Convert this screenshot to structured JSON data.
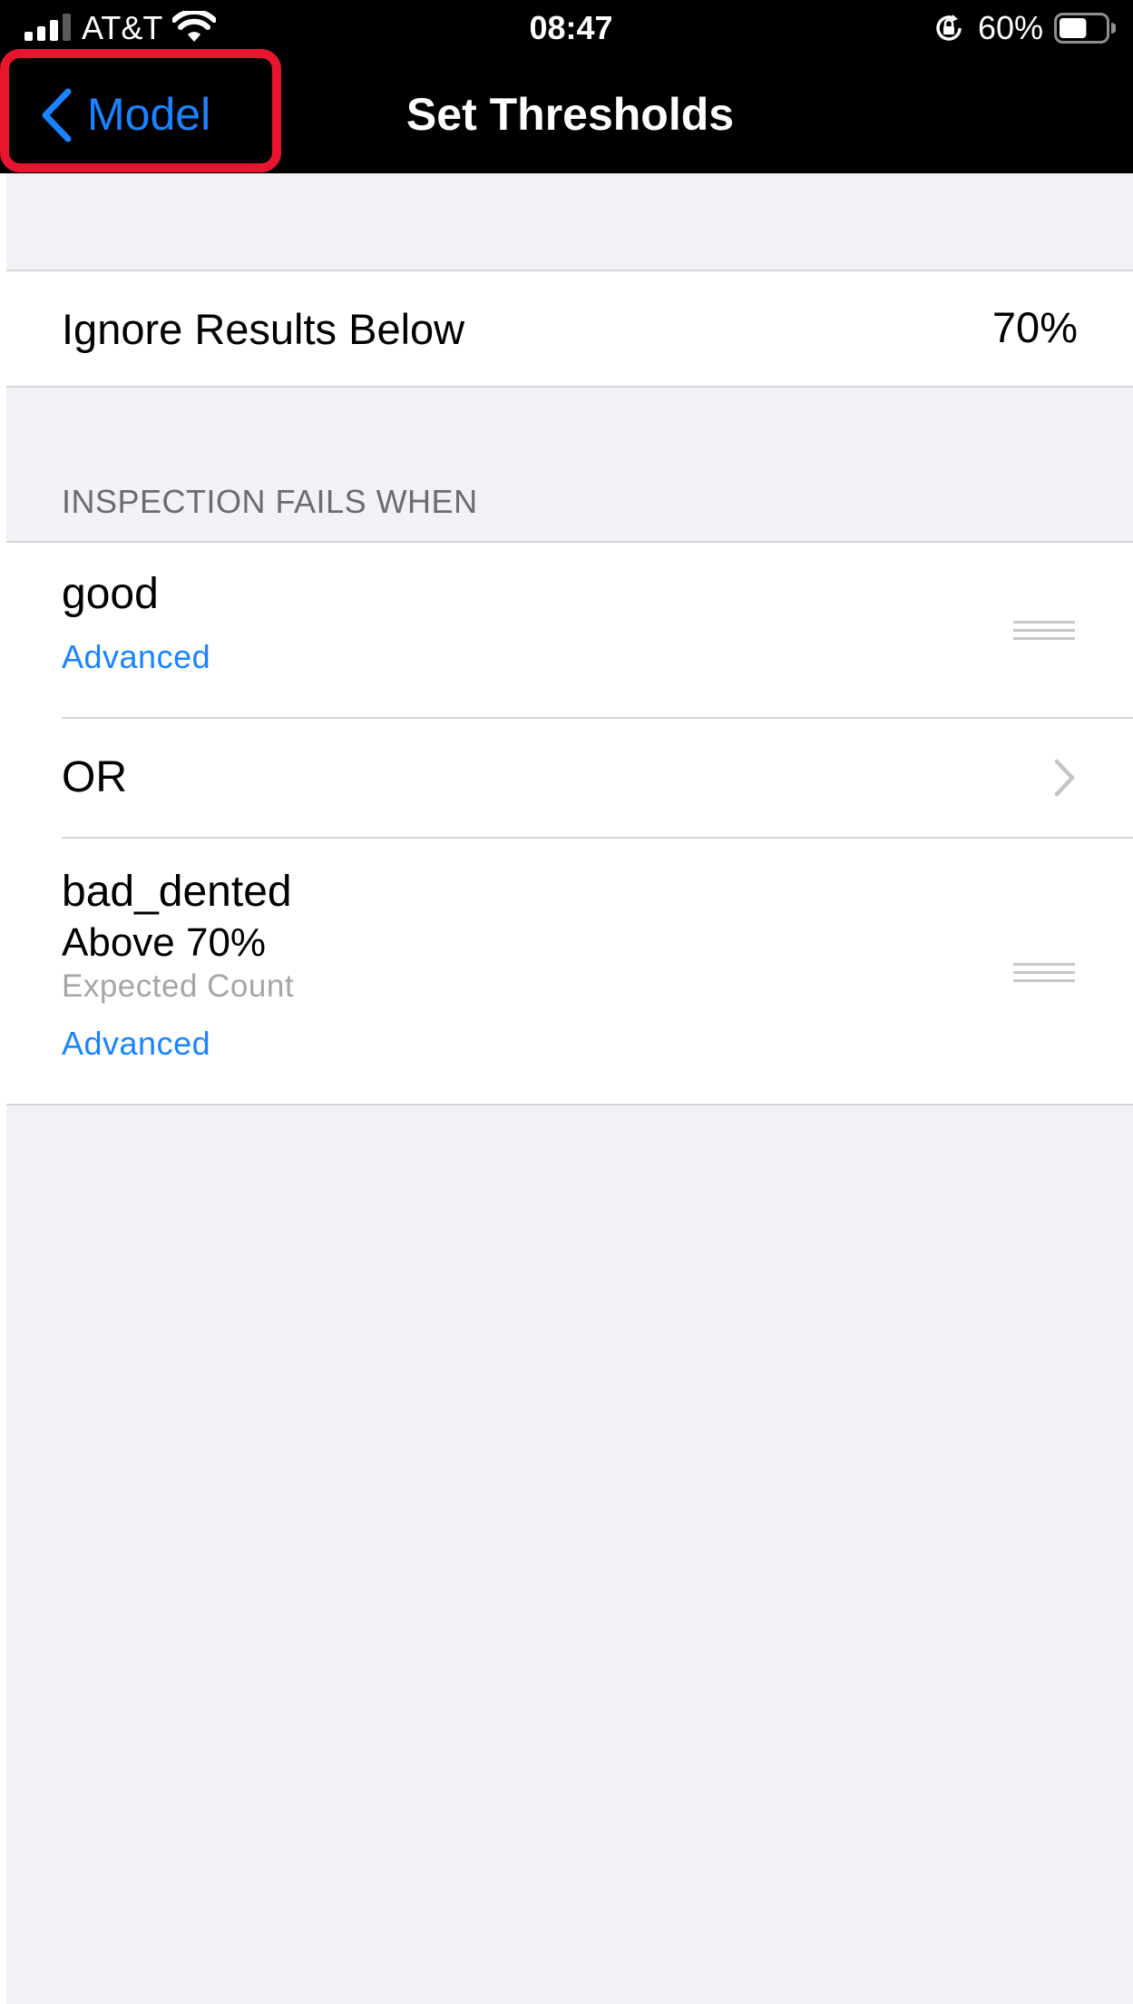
{
  "status_bar": {
    "carrier": "AT&T",
    "time": "08:47",
    "battery_percent": "60%",
    "signal_bars_filled": 3,
    "signal_bars_total": 4,
    "battery_level": 0.6
  },
  "nav": {
    "back_label": "Model",
    "title": "Set Thresholds",
    "highlight_color": "#e8152f"
  },
  "threshold": {
    "label": "Ignore Results Below",
    "value": "70%"
  },
  "section": {
    "header": "INSPECTION FAILS WHEN"
  },
  "conditions": [
    {
      "title": "good",
      "advanced_label": "Advanced",
      "icon": "drag-handle-icon"
    },
    {
      "operator": "OR",
      "icon": "chevron-right-icon"
    },
    {
      "title": "bad_dented",
      "subtitle": "Above 70%",
      "hint": "Expected Count",
      "advanced_label": "Advanced",
      "icon": "drag-handle-icon"
    }
  ],
  "colors": {
    "accent": "#1a83ff",
    "background": "#f1f1f6",
    "nav_background": "#000000"
  }
}
